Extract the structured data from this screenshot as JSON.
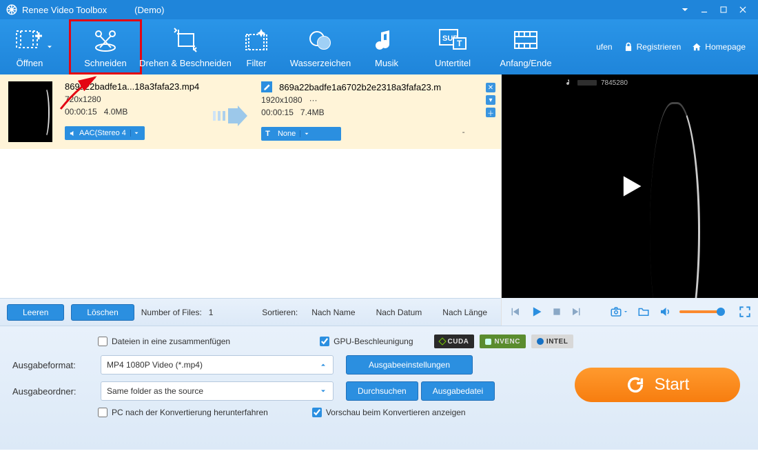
{
  "title": "Renee Video Toolbox",
  "title_suffix": "(Demo)",
  "toolbar": {
    "open": "Öffnen",
    "cut": "Schneiden",
    "crop": "Drehen & Beschneiden",
    "filter": "Filter",
    "watermark": "Wasserzeichen",
    "music": "Musik",
    "subtitle": "Untertitel",
    "startend": "Anfang/Ende"
  },
  "rlinks": {
    "buy": "ufen",
    "register": "Registrieren",
    "home": "Homepage"
  },
  "file": {
    "in_name": "869a22badfe1a...18a3fafa23.mp4",
    "in_res": "720x1280",
    "in_dur": "00:00:15",
    "in_size": "4.0MB",
    "out_name": "869a22badfe1a6702b2e2318a3fafa23.m",
    "out_res": "1920x1080",
    "out_more": "···",
    "out_dur": "00:00:15",
    "out_size": "7.4MB",
    "audio_chip": "AAC(Stereo 4",
    "sub_chip": "None",
    "dash": "-"
  },
  "listbar": {
    "clear": "Leeren",
    "delete": "Löschen",
    "count_label": "Number of Files:",
    "count": "1",
    "sort_label": "Sortieren:",
    "sort_name": "Nach Name",
    "sort_date": "Nach Datum",
    "sort_len": "Nach Länge"
  },
  "preview_id": "7845280",
  "footer": {
    "merge": "Dateien in eine zusammenfügen",
    "gpu": "GPU-Beschleunigung",
    "badges": {
      "cuda": "CUDA",
      "nvenc": "NVENC",
      "intel": "INTEL"
    },
    "format_label": "Ausgabeformat:",
    "format_value": "MP4 1080P Video (*.mp4)",
    "settings": "Ausgabeeinstellungen",
    "folder_label": "Ausgabeordner:",
    "folder_value": "Same folder as the source",
    "browse": "Durchsuchen",
    "outfile": "Ausgabedatei",
    "shutdown": "PC nach der Konvertierung herunterfahren",
    "preview_chk": "Vorschau beim Konvertieren anzeigen",
    "start": "Start"
  }
}
